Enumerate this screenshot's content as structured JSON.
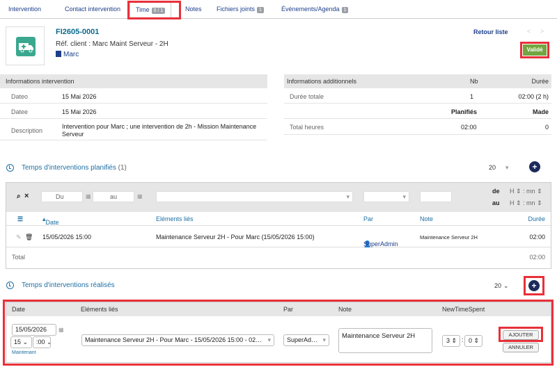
{
  "tabs": [
    {
      "label": "Intervention"
    },
    {
      "label": "Contact intervention"
    },
    {
      "label": "Time",
      "count": "0 / 1"
    },
    {
      "label": "Notes"
    },
    {
      "label": "Fichiers joints",
      "count": "1"
    },
    {
      "label": "Événements/Agenda",
      "count": "1"
    }
  ],
  "header": {
    "ref": "FI2605-0001",
    "ref_client": "Réf. client : Marc Maint Serveur - 2H",
    "client": "Marc",
    "back_link": "Retour liste",
    "status": "Validé",
    "nav_prev": "<",
    "nav_next": ">"
  },
  "info": {
    "title": "Informations intervention",
    "rows": [
      {
        "label": "Dateo",
        "value": "15 Mai 2026"
      },
      {
        "label": "Datee",
        "value": "15 Mai 2026"
      },
      {
        "label": "Description",
        "value": "Intervention pour Marc ; une intervention de 2h - Mission Maintenance Serveur"
      }
    ]
  },
  "additional": {
    "title": "Informations additionnels",
    "col_nb": "Nb",
    "col_duree": "Durée",
    "duree_totale_label": "Durée totale",
    "duree_totale_nb": "1",
    "duree_totale_value": "02:00 (2 h)",
    "planifies": "Planifiés",
    "made": "Made",
    "total_heures_label": "Total heures",
    "total_planifies": "02:00",
    "total_made": "0"
  },
  "planned": {
    "title": "Temps d'interventions planifiés",
    "count": "(1)",
    "page_size": "20",
    "filter_du": "Du",
    "filter_au": "au",
    "de_label": "de",
    "au_label": "au",
    "h_ph": "H",
    "mn_ph": "mn",
    "columns": {
      "date": "Date",
      "elements": "Eléments liés",
      "par": "Par",
      "note": "Note",
      "duree": "Durée"
    },
    "row": {
      "date": "15/05/2026 15:00",
      "elements": "Maintenance Serveur 2H - Pour Marc (15/05/2026 15:00)",
      "par": "SuperAdmin",
      "note": "Maintenance Serveur 2H",
      "duree": "02:00"
    },
    "total_label": "Total",
    "total_value": "02:00"
  },
  "done": {
    "title": "Temps d'interventions réalisés",
    "page_size": "20"
  },
  "form": {
    "columns": {
      "date": "Date",
      "elements": "Eléments liés",
      "par": "Par",
      "note": "Note",
      "newtime": "NewTimeSpent"
    },
    "date_value": "15/05/2026",
    "hour_value": "15",
    "min_value": ":00",
    "now_link": "Maintenant",
    "elements_value": "Maintenance Serveur 2H - Pour Marc - 15/05/2026 15:00 - 02…",
    "par_value": "SuperAd…",
    "note_value": "Maintenance Serveur 2H",
    "spent_h": "3",
    "spent_m": "0",
    "add_button": "AJOUTER",
    "cancel_button": "ANNULER"
  },
  "colors": {
    "accent": "#1d6fa3",
    "status_green": "#74a541",
    "highlight": "#e8303a",
    "logo": "#3aa88e"
  }
}
